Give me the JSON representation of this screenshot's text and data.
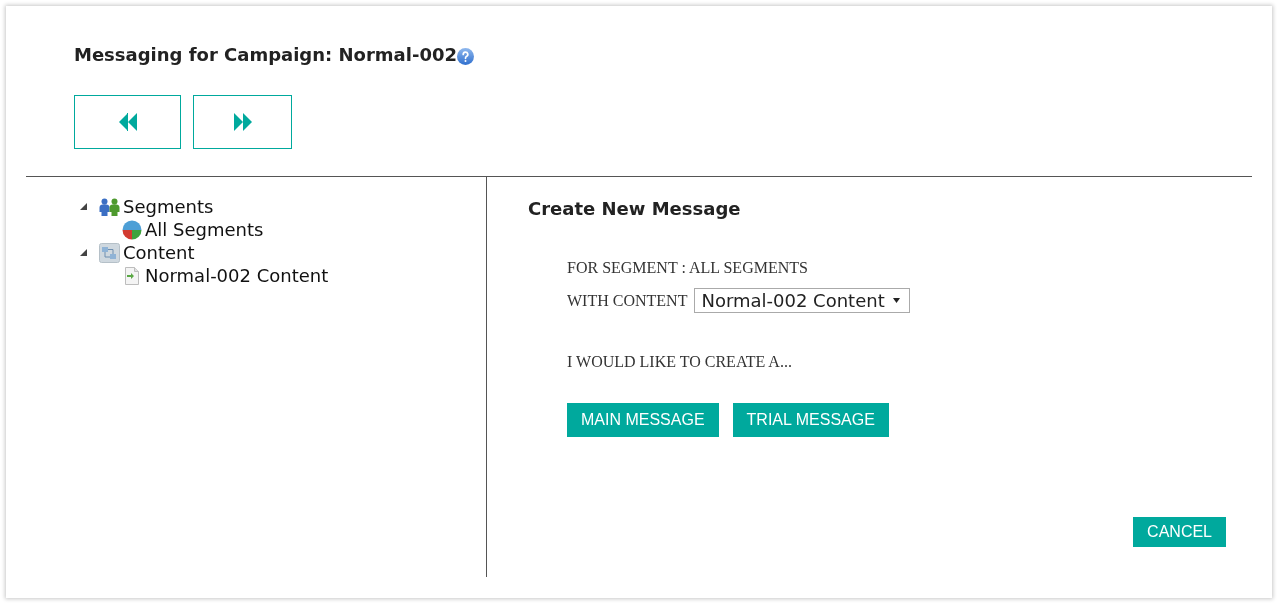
{
  "header": {
    "title": "Messaging for Campaign: Normal-002"
  },
  "tree": [
    {
      "kind": "segments",
      "label": "Segments",
      "expanded": true,
      "children": [
        {
          "kind": "segment",
          "label": "All Segments"
        }
      ]
    },
    {
      "kind": "content",
      "label": "Content",
      "expanded": true,
      "children": [
        {
          "kind": "content-item",
          "label": "Normal-002 Content"
        }
      ]
    }
  ],
  "panel": {
    "title": "Create New Message",
    "segment_line": "FOR SEGMENT : ALL SEGMENTS",
    "content_label": "WITH CONTENT",
    "content_select": {
      "value": "Normal-002 Content"
    },
    "prompt": "I WOULD LIKE TO CREATE A...",
    "buttons": [
      "MAIN MESSAGE",
      "TRIAL MESSAGE"
    ]
  },
  "footer": {
    "buttons": [
      "CANCEL"
    ]
  }
}
